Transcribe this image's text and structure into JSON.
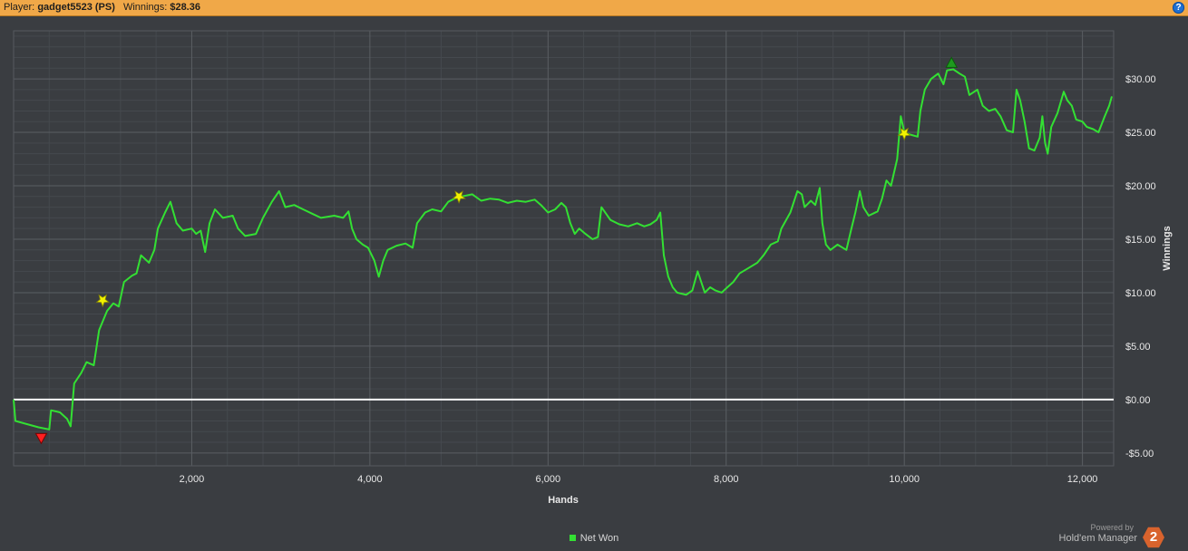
{
  "header": {
    "player_label": "Player:",
    "player_value": "gadget5523 (PS)",
    "winnings_label": "Winnings:",
    "winnings_value": "$28.36",
    "help_glyph": "?"
  },
  "legend": {
    "label": "Net Won",
    "color": "#33e033"
  },
  "branding": {
    "powered_by": "Powered by",
    "name": "Hold'em Manager",
    "logo_text": "2"
  },
  "chart_data": {
    "type": "line",
    "xlabel": "Hands",
    "ylabel": "Winnings",
    "xlim": [
      0,
      12350
    ],
    "ylim": [
      -6.2,
      34.5
    ],
    "x_ticks": [
      2000,
      4000,
      6000,
      8000,
      10000,
      12000
    ],
    "x_tick_labels": [
      "2,000",
      "4,000",
      "6,000",
      "8,000",
      "10,000",
      "12,000"
    ],
    "y_ticks": [
      -5,
      0,
      5,
      10,
      15,
      20,
      25,
      30
    ],
    "y_tick_labels": [
      "-$5.00",
      "$0.00",
      "$5.00",
      "$10.00",
      "$15.00",
      "$20.00",
      "$25.00",
      "$30.00"
    ],
    "grid": true,
    "zero_line": true,
    "series": [
      {
        "name": "Net Won",
        "color": "#33e033",
        "points": [
          [
            0,
            0
          ],
          [
            20,
            -2.0
          ],
          [
            150,
            -2.3
          ],
          [
            280,
            -2.6
          ],
          [
            400,
            -2.8
          ],
          [
            420,
            -1.0
          ],
          [
            520,
            -1.2
          ],
          [
            600,
            -1.8
          ],
          [
            640,
            -2.5
          ],
          [
            680,
            1.5
          ],
          [
            760,
            2.5
          ],
          [
            820,
            3.5
          ],
          [
            900,
            3.2
          ],
          [
            960,
            6.5
          ],
          [
            1050,
            8.3
          ],
          [
            1120,
            9.0
          ],
          [
            1180,
            8.7
          ],
          [
            1240,
            11.0
          ],
          [
            1330,
            11.6
          ],
          [
            1380,
            11.8
          ],
          [
            1430,
            13.5
          ],
          [
            1520,
            12.8
          ],
          [
            1580,
            14.0
          ],
          [
            1620,
            16.0
          ],
          [
            1700,
            17.5
          ],
          [
            1760,
            18.5
          ],
          [
            1830,
            16.5
          ],
          [
            1900,
            15.8
          ],
          [
            2000,
            16.0
          ],
          [
            2050,
            15.5
          ],
          [
            2100,
            15.8
          ],
          [
            2150,
            13.8
          ],
          [
            2200,
            16.5
          ],
          [
            2260,
            17.8
          ],
          [
            2350,
            17.0
          ],
          [
            2460,
            17.2
          ],
          [
            2520,
            16.0
          ],
          [
            2600,
            15.3
          ],
          [
            2720,
            15.5
          ],
          [
            2800,
            17.0
          ],
          [
            2900,
            18.5
          ],
          [
            2980,
            19.5
          ],
          [
            3050,
            18.0
          ],
          [
            3150,
            18.2
          ],
          [
            3250,
            17.8
          ],
          [
            3350,
            17.4
          ],
          [
            3450,
            17.0
          ],
          [
            3600,
            17.2
          ],
          [
            3700,
            17.0
          ],
          [
            3760,
            17.6
          ],
          [
            3800,
            16.0
          ],
          [
            3850,
            15.0
          ],
          [
            3920,
            14.5
          ],
          [
            3980,
            14.2
          ],
          [
            4050,
            13.0
          ],
          [
            4100,
            11.5
          ],
          [
            4150,
            13.0
          ],
          [
            4200,
            14.0
          ],
          [
            4300,
            14.4
          ],
          [
            4400,
            14.6
          ],
          [
            4480,
            14.2
          ],
          [
            4530,
            16.5
          ],
          [
            4620,
            17.5
          ],
          [
            4700,
            17.8
          ],
          [
            4800,
            17.6
          ],
          [
            4880,
            18.5
          ],
          [
            4950,
            18.8
          ],
          [
            5030,
            19.0
          ],
          [
            5150,
            19.2
          ],
          [
            5250,
            18.6
          ],
          [
            5350,
            18.8
          ],
          [
            5450,
            18.7
          ],
          [
            5550,
            18.4
          ],
          [
            5650,
            18.6
          ],
          [
            5750,
            18.5
          ],
          [
            5850,
            18.7
          ],
          [
            5920,
            18.2
          ],
          [
            6000,
            17.5
          ],
          [
            6080,
            17.8
          ],
          [
            6150,
            18.4
          ],
          [
            6200,
            18.0
          ],
          [
            6250,
            16.5
          ],
          [
            6300,
            15.5
          ],
          [
            6350,
            16.0
          ],
          [
            6420,
            15.5
          ],
          [
            6500,
            15.0
          ],
          [
            6560,
            15.2
          ],
          [
            6600,
            18.0
          ],
          [
            6650,
            17.4
          ],
          [
            6700,
            16.8
          ],
          [
            6800,
            16.4
          ],
          [
            6900,
            16.2
          ],
          [
            7000,
            16.5
          ],
          [
            7080,
            16.2
          ],
          [
            7150,
            16.4
          ],
          [
            7220,
            16.8
          ],
          [
            7260,
            17.5
          ],
          [
            7300,
            13.5
          ],
          [
            7350,
            11.5
          ],
          [
            7400,
            10.5
          ],
          [
            7450,
            10.0
          ],
          [
            7550,
            9.8
          ],
          [
            7620,
            10.2
          ],
          [
            7680,
            12.0
          ],
          [
            7720,
            11.0
          ],
          [
            7760,
            10.0
          ],
          [
            7820,
            10.5
          ],
          [
            7880,
            10.2
          ],
          [
            7950,
            10.0
          ],
          [
            8000,
            10.4
          ],
          [
            8080,
            11.0
          ],
          [
            8150,
            11.8
          ],
          [
            8250,
            12.3
          ],
          [
            8350,
            12.8
          ],
          [
            8420,
            13.5
          ],
          [
            8500,
            14.5
          ],
          [
            8580,
            14.8
          ],
          [
            8620,
            16.0
          ],
          [
            8720,
            17.5
          ],
          [
            8800,
            19.5
          ],
          [
            8850,
            19.2
          ],
          [
            8880,
            18.0
          ],
          [
            8950,
            18.6
          ],
          [
            9000,
            18.2
          ],
          [
            9050,
            19.8
          ],
          [
            9080,
            16.5
          ],
          [
            9120,
            14.5
          ],
          [
            9170,
            14.0
          ],
          [
            9250,
            14.5
          ],
          [
            9350,
            14.0
          ],
          [
            9400,
            15.8
          ],
          [
            9450,
            17.5
          ],
          [
            9500,
            19.5
          ],
          [
            9540,
            18.0
          ],
          [
            9600,
            17.2
          ],
          [
            9700,
            17.6
          ],
          [
            9750,
            18.8
          ],
          [
            9800,
            20.5
          ],
          [
            9850,
            20.0
          ],
          [
            9920,
            22.5
          ],
          [
            9960,
            26.5
          ],
          [
            10000,
            25.0
          ],
          [
            10060,
            24.8
          ],
          [
            10150,
            24.6
          ],
          [
            10180,
            27.0
          ],
          [
            10230,
            29.0
          ],
          [
            10300,
            30.0
          ],
          [
            10380,
            30.5
          ],
          [
            10440,
            29.5
          ],
          [
            10480,
            30.8
          ],
          [
            10550,
            30.9
          ],
          [
            10620,
            30.5
          ],
          [
            10680,
            30.2
          ],
          [
            10730,
            28.5
          ],
          [
            10820,
            29.0
          ],
          [
            10880,
            27.5
          ],
          [
            10950,
            27.0
          ],
          [
            11020,
            27.2
          ],
          [
            11080,
            26.5
          ],
          [
            11150,
            25.2
          ],
          [
            11220,
            25.0
          ],
          [
            11260,
            29.0
          ],
          [
            11300,
            28.0
          ],
          [
            11350,
            26.0
          ],
          [
            11400,
            23.5
          ],
          [
            11460,
            23.3
          ],
          [
            11520,
            24.5
          ],
          [
            11550,
            26.5
          ],
          [
            11580,
            24.0
          ],
          [
            11610,
            23.0
          ],
          [
            11650,
            25.5
          ],
          [
            11720,
            26.8
          ],
          [
            11790,
            28.8
          ],
          [
            11830,
            28.0
          ],
          [
            11880,
            27.5
          ],
          [
            11930,
            26.2
          ],
          [
            12000,
            26.0
          ],
          [
            12050,
            25.5
          ],
          [
            12120,
            25.3
          ],
          [
            12180,
            25.0
          ],
          [
            12250,
            26.5
          ],
          [
            12300,
            27.5
          ],
          [
            12330,
            28.36
          ]
        ]
      }
    ],
    "markers": [
      {
        "kind": "min",
        "shape": "triangle-down",
        "color": "#ff2020",
        "x": 310,
        "y": -3.6
      },
      {
        "kind": "milestone",
        "shape": "star",
        "color": "#f2f200",
        "x": 1000,
        "y": 9.3
      },
      {
        "kind": "milestone",
        "shape": "star",
        "color": "#f2f200",
        "x": 5000,
        "y": 19.0
      },
      {
        "kind": "milestone",
        "shape": "star",
        "color": "#f2f200",
        "x": 10000,
        "y": 24.9
      },
      {
        "kind": "max",
        "shape": "triangle-up",
        "color": "#1e9a1e",
        "x": 10530,
        "y": 31.5
      }
    ]
  }
}
